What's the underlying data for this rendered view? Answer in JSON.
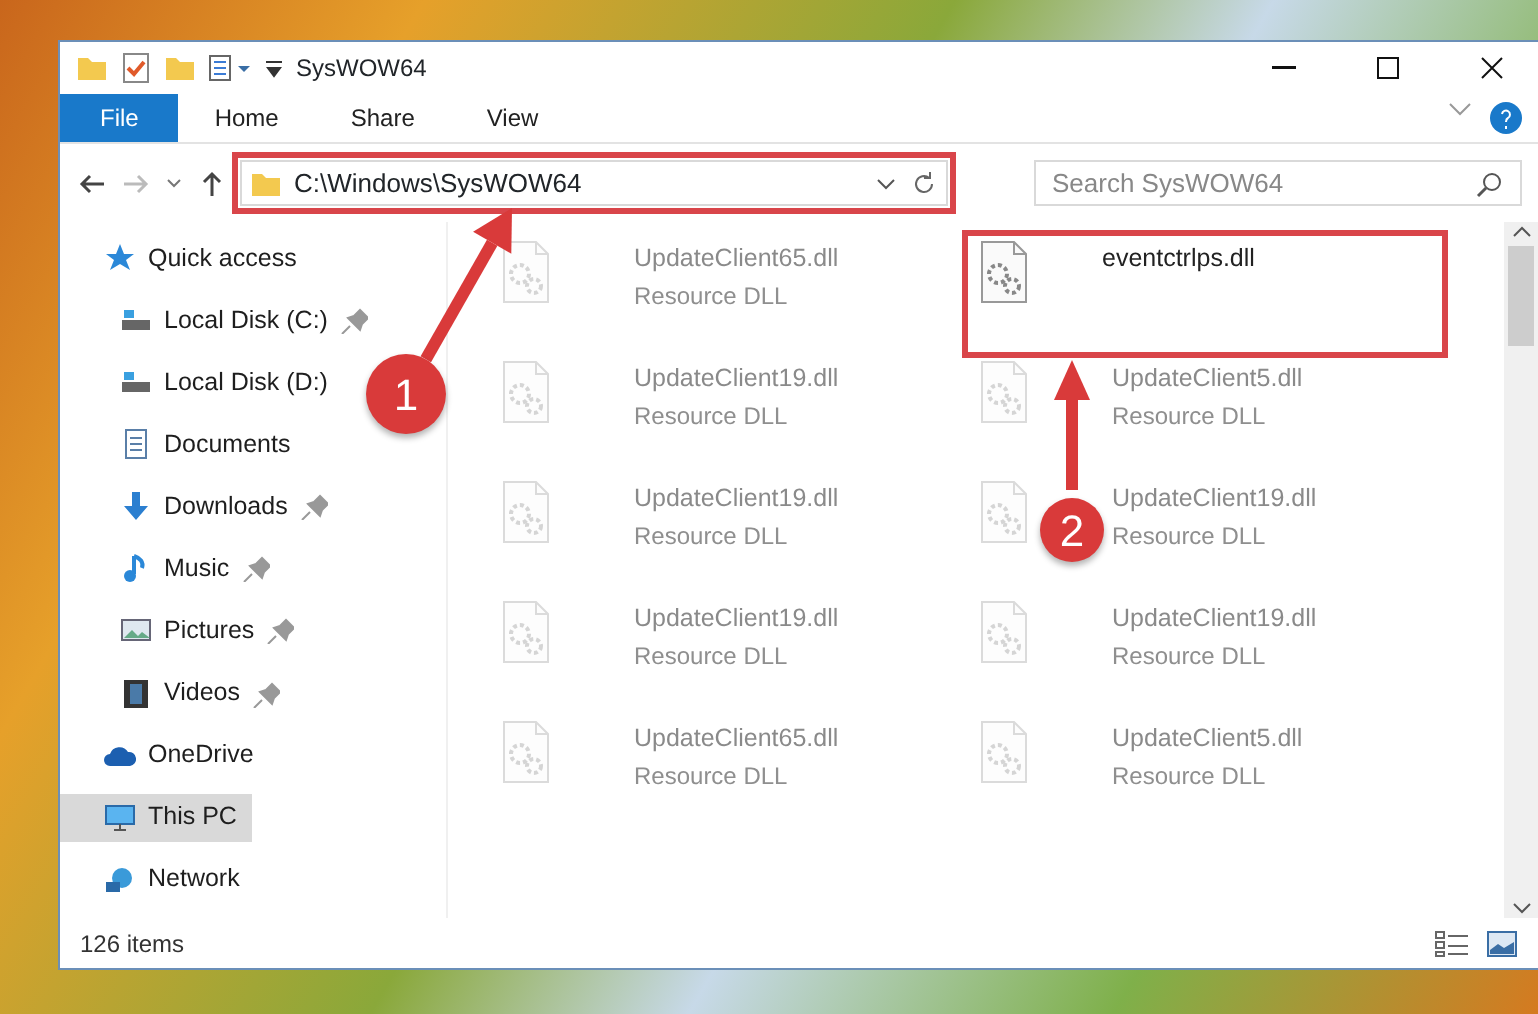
{
  "window": {
    "title": "SysWOW64"
  },
  "ribbon_tabs": [
    {
      "label": "File",
      "selected": true
    },
    {
      "label": "Home",
      "selected": false
    },
    {
      "label": "Share",
      "selected": false
    },
    {
      "label": "View",
      "selected": false
    }
  ],
  "address": {
    "path": "C:\\Windows\\SysWOW64"
  },
  "search": {
    "placeholder": "Search SysWOW64"
  },
  "sidebar": {
    "items": [
      {
        "label": "Quick access",
        "kind": "star",
        "pinned": false,
        "selected": false,
        "children": [
          {
            "label": "Local Disk (C:)",
            "kind": "drive",
            "pinned": true,
            "selected": false
          },
          {
            "label": "Local Disk (D:)",
            "kind": "drive",
            "pinned": false,
            "selected": false
          },
          {
            "label": "Documents",
            "kind": "document",
            "pinned": false,
            "selected": false
          },
          {
            "label": "Downloads",
            "kind": "download",
            "pinned": true,
            "selected": false
          },
          {
            "label": "Music",
            "kind": "music",
            "pinned": true,
            "selected": false
          },
          {
            "label": "Pictures",
            "kind": "picture",
            "pinned": true,
            "selected": false
          },
          {
            "label": "Videos",
            "kind": "video",
            "pinned": true,
            "selected": false
          }
        ]
      },
      {
        "label": "OneDrive",
        "kind": "cloud",
        "pinned": false,
        "selected": false
      },
      {
        "label": "This PC",
        "kind": "computer",
        "pinned": false,
        "selected": true
      },
      {
        "label": "Network",
        "kind": "network",
        "pinned": false,
        "selected": false
      }
    ]
  },
  "files": [
    {
      "name": "UpdateClient65.dll",
      "type": "Resource DLL",
      "dimmed": true,
      "highlighted": false
    },
    {
      "name": "eventctrlps.dll",
      "dimmed": false,
      "highlighted": true
    },
    {
      "name": "UpdateClient19.dll",
      "type": "Resource DLL",
      "dimmed": true,
      "highlighted": false
    },
    {
      "name": "UpdateClient5.dll",
      "type": "Resource DLL",
      "dimmed": true,
      "highlighted": false
    },
    {
      "name": "UpdateClient19.dll",
      "type": "Resource DLL",
      "dimmed": true,
      "highlighted": false
    },
    {
      "name": "UpdateClient19.dll",
      "type": "Resource DLL",
      "dimmed": true,
      "highlighted": false
    },
    {
      "name": "UpdateClient19.dll",
      "type": "Resource DLL",
      "dimmed": true,
      "highlighted": false
    },
    {
      "name": "UpdateClient19.dll",
      "type": "Resource DLL",
      "dimmed": true,
      "highlighted": false
    },
    {
      "name": "UpdateClient65.dll",
      "type": "Resource DLL",
      "dimmed": true,
      "highlighted": false
    },
    {
      "name": "UpdateClient5.dll",
      "type": "Resource DLL",
      "dimmed": true,
      "highlighted": false
    }
  ],
  "status_bar": {
    "item_count": "126 items"
  },
  "annotations": [
    {
      "number": "1"
    },
    {
      "number": "2"
    }
  ]
}
